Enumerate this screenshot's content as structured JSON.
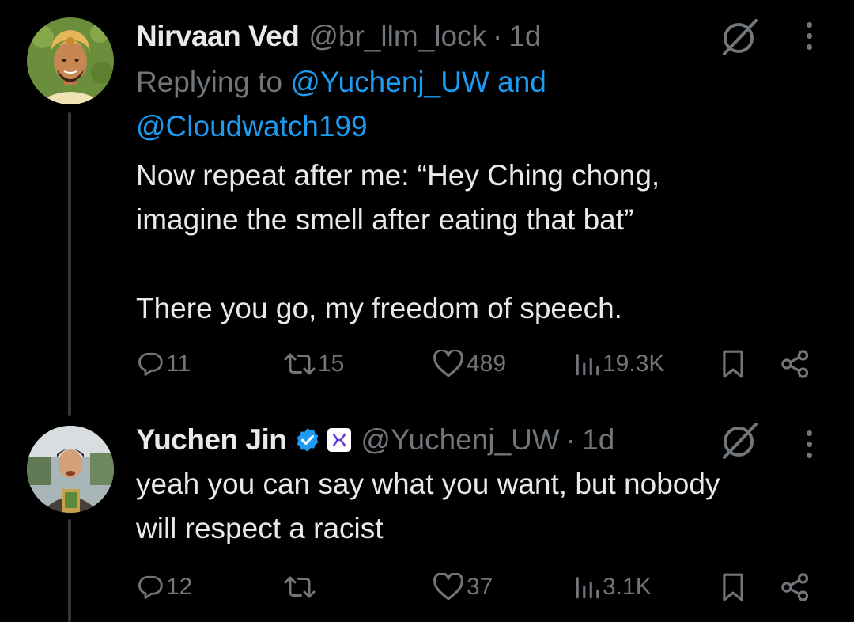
{
  "tweets": [
    {
      "name": "Nirvaan Ved",
      "handle": "@br_llm_lock",
      "dot": "·",
      "time": "1d",
      "reply_prefix": "Replying to ",
      "reply_mention_1": "@Yuchenj_UW",
      "reply_and": " and",
      "reply_mention_2": "@Cloudwatch199",
      "body": "Now repeat after me: “Hey Ching chong,\nimagine the smell after eating that bat”\n\nThere you go, my freedom of speech.",
      "stats": {
        "replies": "11",
        "reposts": "15",
        "likes": "489",
        "views": "19.3K"
      },
      "avatar_icon": "turban-man-avatar"
    },
    {
      "name": "Yuchen Jin",
      "handle": "@Yuchenj_UW",
      "dot": "·",
      "time": "1d",
      "verified": true,
      "org_badge_icon": "hyperbolic-logo-icon",
      "body": "yeah you can say what you want, but nobody\nwill respect a racist",
      "stats": {
        "replies": "12",
        "reposts": "",
        "likes": "37",
        "views": "3.1K"
      },
      "avatar_icon": "photo-avatar"
    }
  ],
  "colors": {
    "background": "#000000",
    "text_primary": "#e7e9ea",
    "text_secondary": "#71767b",
    "link": "#1d9bf0",
    "thread_line": "#333639",
    "verified": "#1d9bf0"
  }
}
